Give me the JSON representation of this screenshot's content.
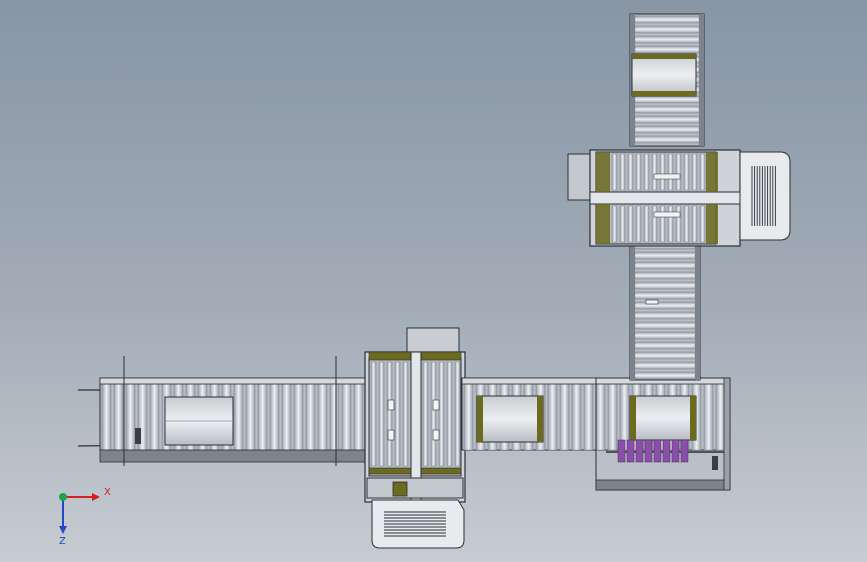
{
  "viewport": {
    "background_top": "#8795a5",
    "background_bottom": "#c7ccd2"
  },
  "colors": {
    "frame_stroke": "#2b2f35",
    "roller_light": "#e6e9ee",
    "roller_dark": "#8e959f",
    "olive_accent": "#6b6a1e",
    "purple_parts": "#8a4fa8",
    "axis_x": "#d42020",
    "axis_y": "#1fa34a",
    "axis_z": "#2546c8"
  },
  "triad": {
    "x_label": "X",
    "z_label": "Z"
  }
}
